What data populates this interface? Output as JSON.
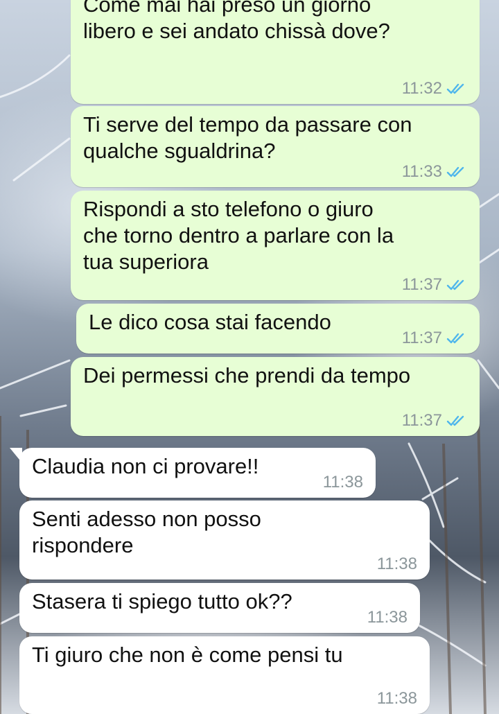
{
  "chat": {
    "messages": [
      {
        "direction": "outgoing",
        "text": "Come mai hai preso un giorno\nlibero e sei andato chissà dove?",
        "time": "11:32",
        "status": "read"
      },
      {
        "direction": "outgoing",
        "text": "Ti serve del tempo da passare con\nqualche sgualdrina?",
        "time": "11:33",
        "status": "read"
      },
      {
        "direction": "outgoing",
        "text": "Rispondi a sto telefono o giuro\nche torno dentro a parlare con la\ntua superiora",
        "time": "11:37",
        "status": "read"
      },
      {
        "direction": "outgoing",
        "text": "Le dico cosa stai facendo",
        "time": "11:37",
        "status": "read"
      },
      {
        "direction": "outgoing",
        "text": "Dei permessi che prendi da tempo",
        "time": "11:37",
        "status": "read"
      },
      {
        "direction": "incoming",
        "text": "Claudia non ci provare!!",
        "time": "11:38"
      },
      {
        "direction": "incoming",
        "text": "Senti adesso non posso\nrispondere",
        "time": "11:38"
      },
      {
        "direction": "incoming",
        "text": "Stasera ti spiego tutto ok??",
        "time": "11:38"
      },
      {
        "direction": "incoming",
        "text": "Ti giuro che non è come pensi tu",
        "time": "11:38"
      }
    ]
  },
  "colors": {
    "outgoing_bubble": "#e7fed5",
    "incoming_bubble": "#ffffff",
    "timestamp": "#8b969a",
    "read_ticks": "#4fb6ec"
  },
  "icons": {
    "read_receipt": "double-check-icon"
  }
}
